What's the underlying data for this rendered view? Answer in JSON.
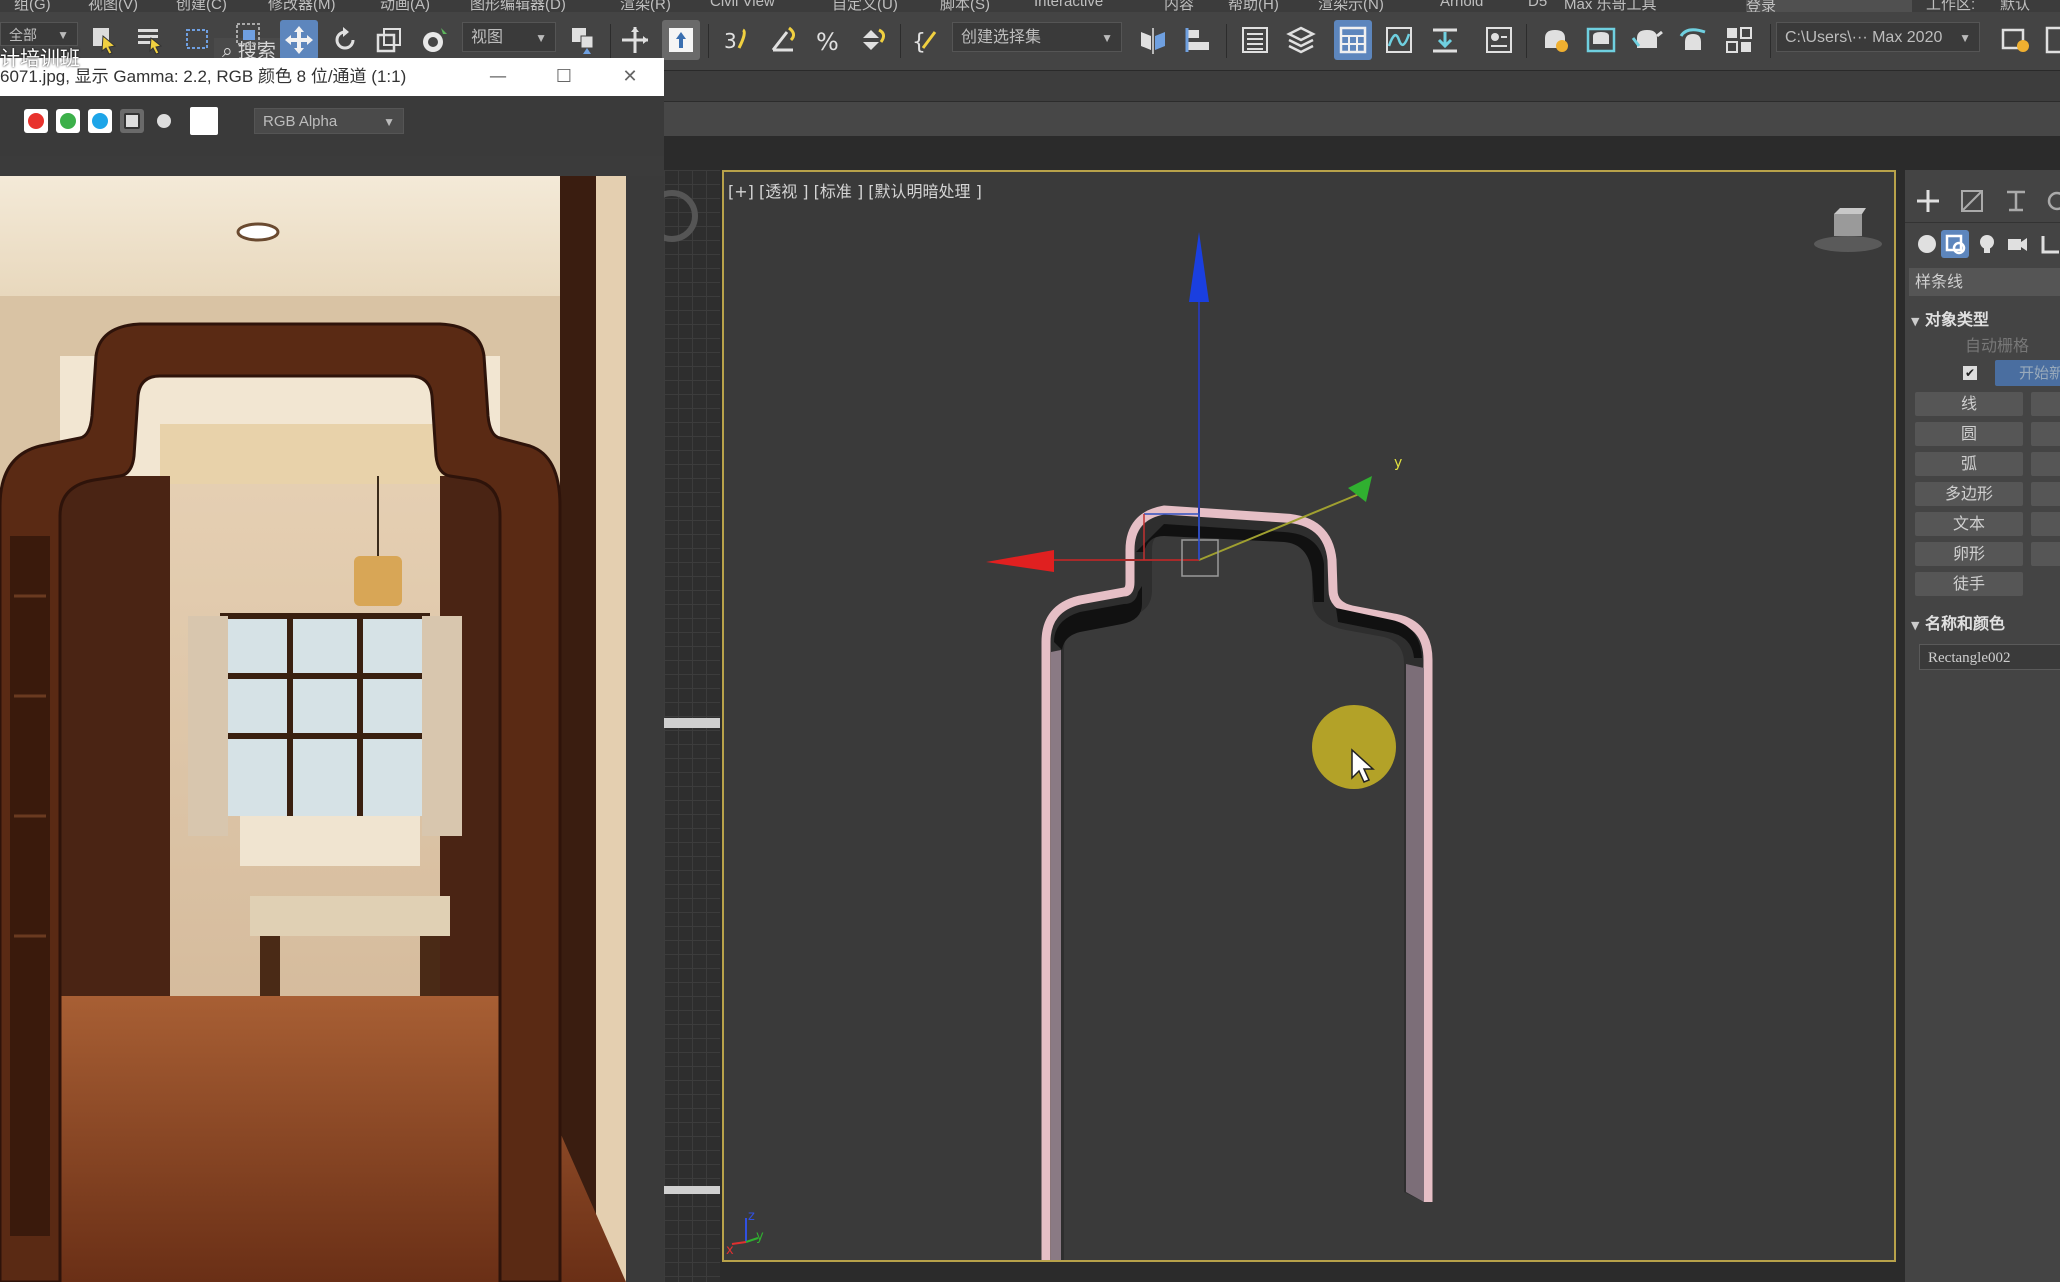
{
  "menu": {
    "items": [
      "组(G)",
      "视图(V)",
      "创建(C)",
      "修改器(M)",
      "动画(A)",
      "图形编辑器(D)",
      "渲染(R)",
      "Civil View",
      "自定义(U)",
      "脚本(S)",
      "Interactive",
      "内容",
      "帮助(H)",
      "渲染示(N)",
      "Arnold",
      "D5",
      "Max 乐哥工具"
    ],
    "login": "登录",
    "workspace_label": "工作区:",
    "workspace_value": "默认"
  },
  "toolbar": {
    "filter_value": "全部",
    "search_placeholder": "搜索",
    "ref_coord": "视图",
    "named_selection": "创建选择集",
    "path_value": "C:\\Users\\··· Max 2020"
  },
  "overlay": {
    "text": "计培训班"
  },
  "viewer": {
    "title": "6071.jpg, 显示 Gamma: 2.2, RGB 颜色 8 位/通道 (1:1)",
    "channel": "RGB Alpha",
    "channel_colors": [
      "#e8322d",
      "#3cb04a",
      "#1ea5e8"
    ]
  },
  "viewport": {
    "label": "[+] [透视 ] [标准 ] [默认明暗处理 ]",
    "gizmo": {
      "y_label": "y"
    },
    "axis_tripod": {
      "z": "z",
      "x": "x",
      "y": "y"
    }
  },
  "command_panel": {
    "category": "样条线",
    "object_type_heading": "对象类型",
    "autogrid": "自动栅格",
    "start_new_shape": "开始新",
    "buttons": [
      "线",
      "圆",
      "弧",
      "多边形",
      "文本",
      "卵形",
      "徒手"
    ],
    "name_color_heading": "名称和颜色",
    "object_name": "Rectangle002"
  },
  "colors": {
    "accent_blue": "#5d86bd",
    "viewport_border": "#b8a24a",
    "shape_pink": "#e6bfc6",
    "cursor_highlight": "#c9b526"
  }
}
